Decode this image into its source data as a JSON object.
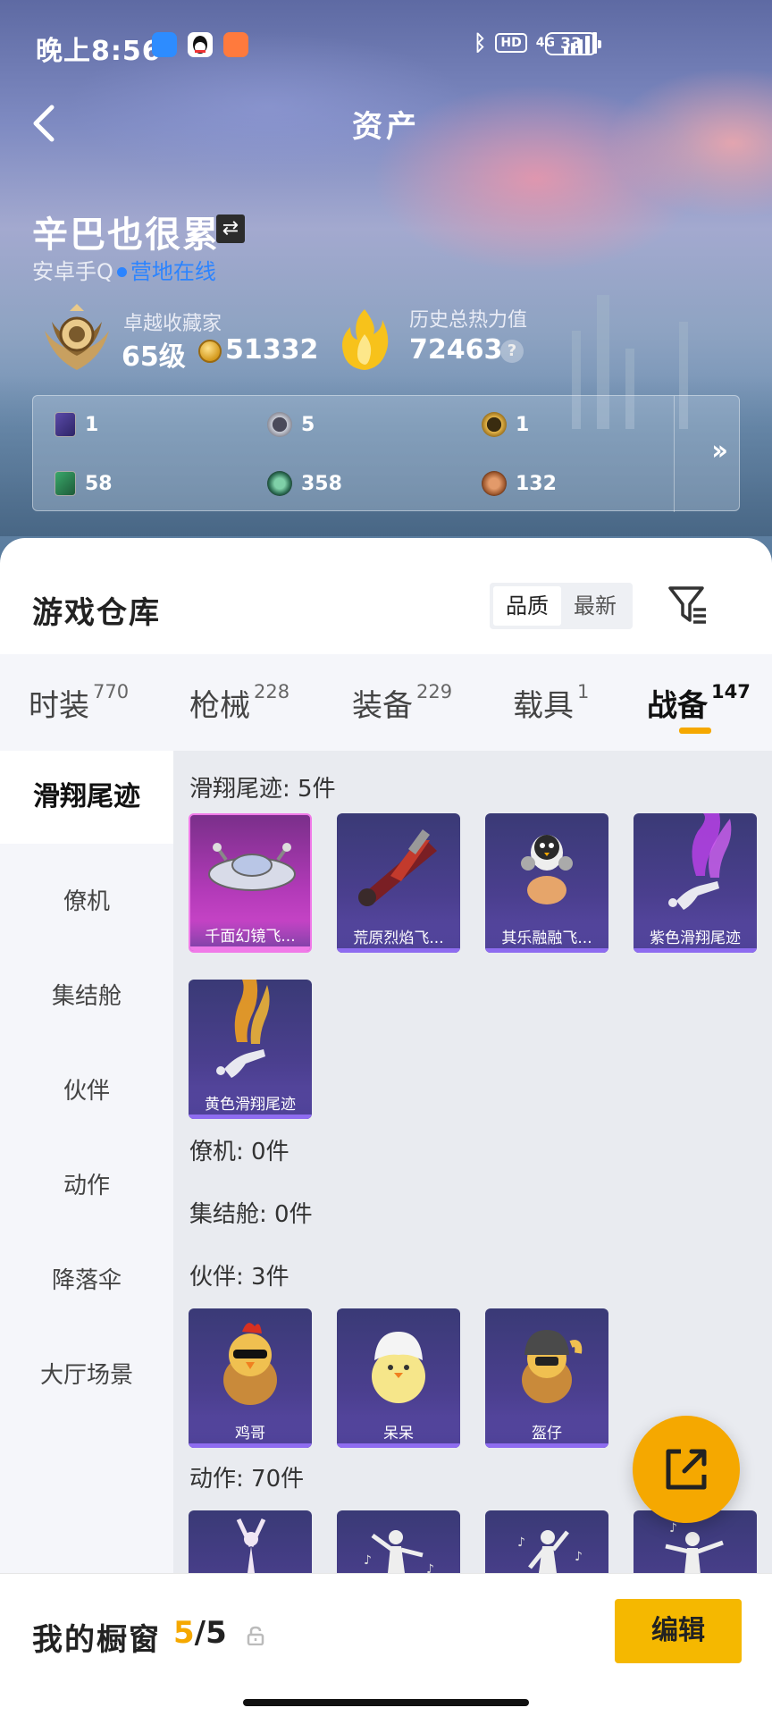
{
  "status_bar": {
    "time": "晚上8:56",
    "network": "4G",
    "hd": "HD",
    "battery": "33"
  },
  "header": {
    "title": "资产"
  },
  "profile": {
    "name": "辛巴也很累",
    "platform": "安卓手Q",
    "status": "营地在线",
    "rank_title": "卓越收藏家",
    "rank_level": "65级",
    "coins": "51332",
    "heat_title": "历史总热力值",
    "heat_value": "72463",
    "help": "?"
  },
  "currencies": [
    {
      "value": "1",
      "icon": "purple-card-icon"
    },
    {
      "value": "5",
      "icon": "silver-coin-icon"
    },
    {
      "value": "1",
      "icon": "gold-coin-icon"
    },
    {
      "value": "58",
      "icon": "green-card-icon"
    },
    {
      "value": "358",
      "icon": "green-coin-icon"
    },
    {
      "value": "132",
      "icon": "bronze-coin-icon"
    }
  ],
  "warehouse": {
    "title": "游戏仓库",
    "sort": [
      "品质",
      "最新"
    ],
    "tabs": [
      {
        "label": "时装",
        "count": "770"
      },
      {
        "label": "枪械",
        "count": "228"
      },
      {
        "label": "装备",
        "count": "229"
      },
      {
        "label": "载具",
        "count": "1"
      },
      {
        "label": "战备",
        "count": "147"
      }
    ],
    "nav": [
      "滑翔尾迹",
      "僚机",
      "集结舱",
      "伙伴",
      "动作",
      "降落伞",
      "大厅场景"
    ],
    "sections": {
      "trails": "滑翔尾迹: 5件",
      "wingman": "僚机: 0件",
      "pod": "集结舱: 0件",
      "partners": "伙伴: 3件",
      "emotes": "动作: 70件"
    },
    "trail_items": [
      "千面幻镜飞...",
      "荒原烈焰飞...",
      "其乐融融飞...",
      "紫色滑翔尾迹",
      "黄色滑翔尾迹"
    ],
    "partner_items": [
      "鸡哥",
      "呆呆",
      "盔仔"
    ]
  },
  "bottom": {
    "showcase_label": "我的橱窗",
    "count_current": "5",
    "count_total": "/5",
    "edit": "编辑"
  },
  "colors": {
    "accent": "#f5a800",
    "online": "#2c84ff",
    "item_purple": "#4b3f8f",
    "item_pink": "#c041c0"
  }
}
